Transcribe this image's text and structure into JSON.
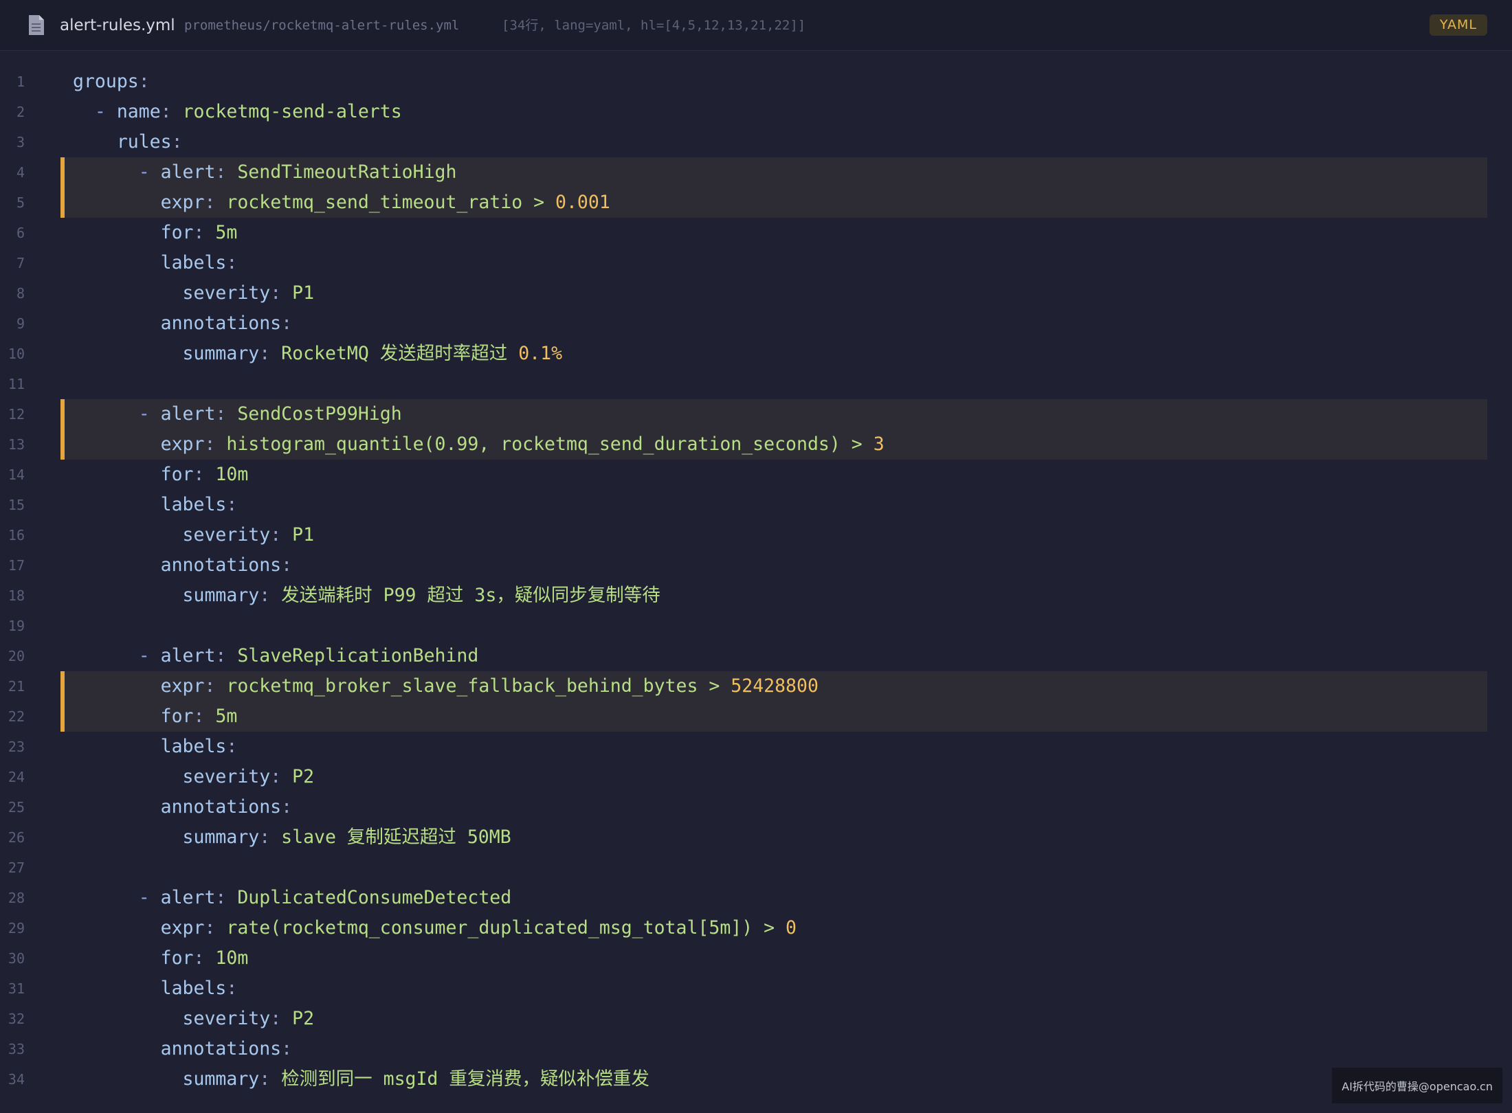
{
  "header": {
    "file_name": "alert-rules.yml",
    "file_path": "prometheus/rocketmq-alert-rules.yml",
    "meta": "[34行, lang=yaml, hl=[4,5,12,13,21,22]]",
    "lang_badge": "YAML"
  },
  "code": {
    "highlighted_lines": [
      4,
      5,
      12,
      13,
      21,
      22
    ],
    "lines": [
      [
        {
          "t": "k",
          "v": "groups"
        },
        {
          "t": "p",
          "v": ":"
        }
      ],
      [
        {
          "t": "dash",
          "v": "  - "
        },
        {
          "t": "k",
          "v": "name"
        },
        {
          "t": "p",
          "v": ": "
        },
        {
          "t": "s",
          "v": "rocketmq-send-alerts"
        }
      ],
      [
        {
          "t": "k",
          "v": "    rules"
        },
        {
          "t": "p",
          "v": ":"
        }
      ],
      [
        {
          "t": "dash",
          "v": "      - "
        },
        {
          "t": "k",
          "v": "alert"
        },
        {
          "t": "p",
          "v": ": "
        },
        {
          "t": "s",
          "v": "SendTimeoutRatioHigh"
        }
      ],
      [
        {
          "t": "k",
          "v": "        expr"
        },
        {
          "t": "p",
          "v": ": "
        },
        {
          "t": "s",
          "v": "rocketmq_send_timeout_ratio > "
        },
        {
          "t": "n",
          "v": "0.001"
        }
      ],
      [
        {
          "t": "k",
          "v": "        for"
        },
        {
          "t": "p",
          "v": ": "
        },
        {
          "t": "s",
          "v": "5m"
        }
      ],
      [
        {
          "t": "k",
          "v": "        labels"
        },
        {
          "t": "p",
          "v": ":"
        }
      ],
      [
        {
          "t": "k",
          "v": "          severity"
        },
        {
          "t": "p",
          "v": ": "
        },
        {
          "t": "s",
          "v": "P1"
        }
      ],
      [
        {
          "t": "k",
          "v": "        annotations"
        },
        {
          "t": "p",
          "v": ":"
        }
      ],
      [
        {
          "t": "k",
          "v": "          summary"
        },
        {
          "t": "p",
          "v": ": "
        },
        {
          "t": "s",
          "v": "RocketMQ 发送超时率超过 "
        },
        {
          "t": "n",
          "v": "0.1%"
        }
      ],
      [],
      [
        {
          "t": "dash",
          "v": "      - "
        },
        {
          "t": "k",
          "v": "alert"
        },
        {
          "t": "p",
          "v": ": "
        },
        {
          "t": "s",
          "v": "SendCostP99High"
        }
      ],
      [
        {
          "t": "k",
          "v": "        expr"
        },
        {
          "t": "p",
          "v": ": "
        },
        {
          "t": "s",
          "v": "histogram_quantile(0.99, rocketmq_send_duration_seconds) > "
        },
        {
          "t": "n",
          "v": "3"
        }
      ],
      [
        {
          "t": "k",
          "v": "        for"
        },
        {
          "t": "p",
          "v": ": "
        },
        {
          "t": "s",
          "v": "10m"
        }
      ],
      [
        {
          "t": "k",
          "v": "        labels"
        },
        {
          "t": "p",
          "v": ":"
        }
      ],
      [
        {
          "t": "k",
          "v": "          severity"
        },
        {
          "t": "p",
          "v": ": "
        },
        {
          "t": "s",
          "v": "P1"
        }
      ],
      [
        {
          "t": "k",
          "v": "        annotations"
        },
        {
          "t": "p",
          "v": ":"
        }
      ],
      [
        {
          "t": "k",
          "v": "          summary"
        },
        {
          "t": "p",
          "v": ": "
        },
        {
          "t": "s",
          "v": "发送端耗时 P99 超过 3s，疑似同步复制等待"
        }
      ],
      [],
      [
        {
          "t": "dash",
          "v": "      - "
        },
        {
          "t": "k",
          "v": "alert"
        },
        {
          "t": "p",
          "v": ": "
        },
        {
          "t": "s",
          "v": "SlaveReplicationBehind"
        }
      ],
      [
        {
          "t": "k",
          "v": "        expr"
        },
        {
          "t": "p",
          "v": ": "
        },
        {
          "t": "s",
          "v": "rocketmq_broker_slave_fallback_behind_bytes > "
        },
        {
          "t": "n",
          "v": "52428800"
        }
      ],
      [
        {
          "t": "k",
          "v": "        for"
        },
        {
          "t": "p",
          "v": ": "
        },
        {
          "t": "s",
          "v": "5m"
        }
      ],
      [
        {
          "t": "k",
          "v": "        labels"
        },
        {
          "t": "p",
          "v": ":"
        }
      ],
      [
        {
          "t": "k",
          "v": "          severity"
        },
        {
          "t": "p",
          "v": ": "
        },
        {
          "t": "s",
          "v": "P2"
        }
      ],
      [
        {
          "t": "k",
          "v": "        annotations"
        },
        {
          "t": "p",
          "v": ":"
        }
      ],
      [
        {
          "t": "k",
          "v": "          summary"
        },
        {
          "t": "p",
          "v": ": "
        },
        {
          "t": "s",
          "v": "slave 复制延迟超过 50MB"
        }
      ],
      [],
      [
        {
          "t": "dash",
          "v": "      - "
        },
        {
          "t": "k",
          "v": "alert"
        },
        {
          "t": "p",
          "v": ": "
        },
        {
          "t": "s",
          "v": "DuplicatedConsumeDetected"
        }
      ],
      [
        {
          "t": "k",
          "v": "        expr"
        },
        {
          "t": "p",
          "v": ": "
        },
        {
          "t": "s",
          "v": "rate(rocketmq_consumer_duplicated_msg_total[5m]) > "
        },
        {
          "t": "n",
          "v": "0"
        }
      ],
      [
        {
          "t": "k",
          "v": "        for"
        },
        {
          "t": "p",
          "v": ": "
        },
        {
          "t": "s",
          "v": "10m"
        }
      ],
      [
        {
          "t": "k",
          "v": "        labels"
        },
        {
          "t": "p",
          "v": ":"
        }
      ],
      [
        {
          "t": "k",
          "v": "          severity"
        },
        {
          "t": "p",
          "v": ": "
        },
        {
          "t": "s",
          "v": "P2"
        }
      ],
      [
        {
          "t": "k",
          "v": "        annotations"
        },
        {
          "t": "p",
          "v": ":"
        }
      ],
      [
        {
          "t": "k",
          "v": "          summary"
        },
        {
          "t": "p",
          "v": ": "
        },
        {
          "t": "s",
          "v": "检测到同一 msgId 重复消费，疑似补偿重发"
        }
      ]
    ]
  },
  "watermark": "AI拆代码的曹操@opencao.cn",
  "colors": {
    "background": "#1f2133",
    "highlight_bg": "#2d2c35",
    "highlight_border": "#e6a53c",
    "key": "#a9c8ee",
    "string": "#b8de86",
    "number": "#f2bf5e"
  },
  "icons": {
    "file": "file-icon"
  }
}
